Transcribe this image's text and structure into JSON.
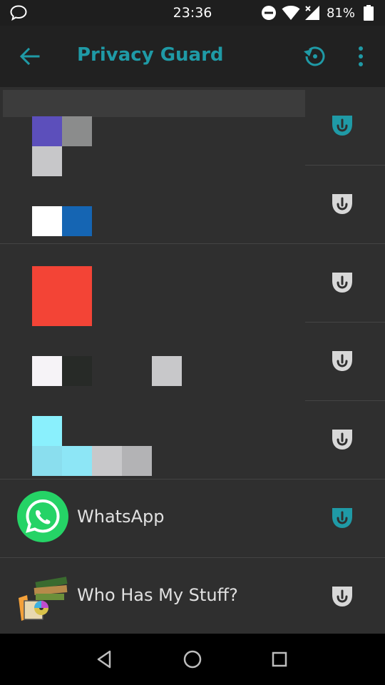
{
  "status_bar": {
    "time": "23:36",
    "battery": "81%",
    "icons": [
      "chat-bubble-icon",
      "do-not-disturb-icon",
      "wifi-icon",
      "cell-signal-icon",
      "battery-icon"
    ]
  },
  "toolbar": {
    "title": "Privacy Guard",
    "back_icon": "arrow-back-icon",
    "reset_icon": "reset-history-icon",
    "more_icon": "more-vert-icon"
  },
  "apps": [
    {
      "name": "",
      "guard_active": true
    },
    {
      "name": "",
      "guard_active": false
    },
    {
      "name": "",
      "guard_active": false
    },
    {
      "name": "",
      "guard_active": false
    },
    {
      "name": "",
      "guard_active": false
    },
    {
      "name": "WhatsApp",
      "guard_active": true
    },
    {
      "name": "Who Has My Stuff?",
      "guard_active": false
    }
  ],
  "colors": {
    "accent": "#1f9aa6",
    "guard_active": "#1f9aa6",
    "guard_inactive": "#d8d8d8",
    "background": "#2f2f2f",
    "toolbar": "#212121",
    "whatsapp_green": "#25d366"
  },
  "navbar": {
    "icons": [
      "back-triangle-icon",
      "home-circle-icon",
      "recents-square-icon"
    ]
  }
}
